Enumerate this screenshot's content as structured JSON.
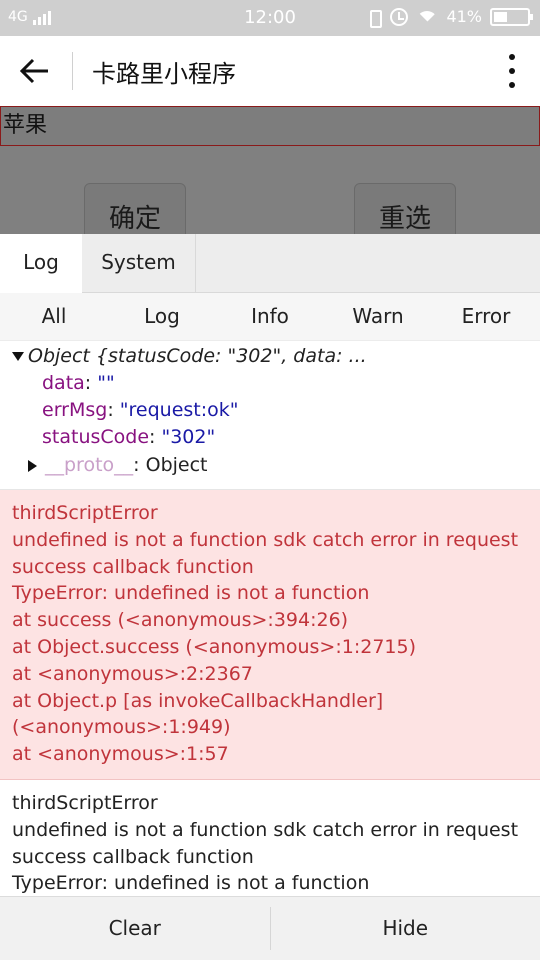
{
  "status_bar": {
    "network": "4G",
    "time": "12:00",
    "battery": "41%",
    "battery_level": 0.41
  },
  "nav": {
    "title": "卡路里小程序"
  },
  "page": {
    "input_value": "苹果",
    "confirm_label": "确定",
    "reset_label": "重选"
  },
  "console": {
    "tabs": [
      {
        "label": "Log"
      },
      {
        "label": "System"
      }
    ],
    "filters": [
      {
        "label": "All"
      },
      {
        "label": "Log"
      },
      {
        "label": "Info"
      },
      {
        "label": "Warn"
      },
      {
        "label": "Error"
      }
    ],
    "object_entry": {
      "summary": "Object {statusCode: \"302\", data: ...",
      "props": [
        {
          "key": "data",
          "value": "\"\""
        },
        {
          "key": "errMsg",
          "value": "\"request:ok\""
        },
        {
          "key": "statusCode",
          "value": "\"302\""
        }
      ],
      "proto_key": "__proto__",
      "proto_value": "Object"
    },
    "error_entry": {
      "lines": [
        "thirdScriptError",
        "undefined is not a function sdk catch error in request",
        "success callback function",
        "TypeError: undefined is not a function",
        "at success (<anonymous>:394:26)",
        "at Object.success (<anonymous>:1:2715)",
        "at <anonymous>:2:2367",
        "at Object.p [as invokeCallbackHandler]",
        "(<anonymous>:1:949)",
        "at <anonymous>:1:57"
      ]
    },
    "plain_entry": {
      "lines": [
        "thirdScriptError",
        "undefined is not a function sdk catch error in request",
        "success callback function",
        "TypeError: undefined is not a function"
      ]
    },
    "footer": {
      "clear_label": "Clear",
      "hide_label": "Hide"
    }
  }
}
